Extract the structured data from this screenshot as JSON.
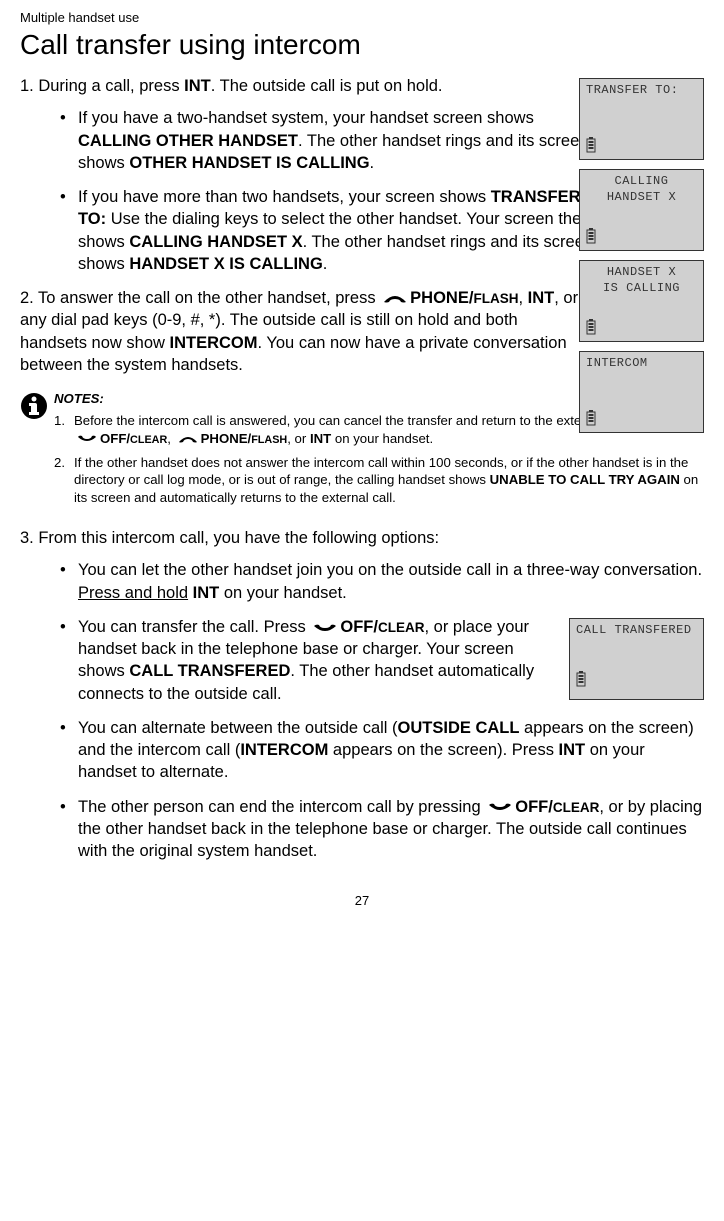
{
  "breadcrumb": "Multiple handset use",
  "title": "Call transfer using intercom",
  "lcd": {
    "transfer_to": "TRANSFER TO:",
    "calling_l1": "CALLING",
    "calling_l2": "HANDSET X",
    "iscalling_l1": "HANDSET X",
    "iscalling_l2": "IS CALLING",
    "intercom": "INTERCOM",
    "call_transfered": "CALL TRANSFERED"
  },
  "step1": {
    "lead_a": "1. During a call, press ",
    "lead_b": "INT",
    "lead_c": ". The outside call is put on hold.",
    "b1_a": "If you have a two-handset system, your handset screen shows ",
    "b1_b": "CALLING OTHER HANDSET",
    "b1_c": ". The other handset rings and its screen shows ",
    "b1_d": "OTHER HANDSET IS CALLING",
    "b1_e": ".",
    "b2_a": "If you have more than two handsets, your screen shows ",
    "b2_b": "TRANSFER TO:",
    "b2_c": " Use the dialing keys to select the other handset. Your screen then shows ",
    "b2_d": "CALLING HANDSET X",
    "b2_e": ". The other handset rings and its screen shows ",
    "b2_f": "HANDSET X IS CALLING",
    "b2_g": "."
  },
  "step2": {
    "a": "2. To answer the call on the other handset, press ",
    "phone_flash": "PHONE/",
    "flash_sc": "FLASH",
    "sep1": ", ",
    "int": "INT",
    "b": ", or any dial pad keys (0-9, #, *). The outside call is still on hold and both handsets now show ",
    "intercom": "INTERCOM",
    "c": ". You can now have a private conversation between the system handsets."
  },
  "notes": {
    "head": "NOTES:",
    "n1_num": "1.",
    "n1_a": "Before the intercom call is answered, you can cancel the transfer and return to the external call by pressing ",
    "off_clear": "OFF/",
    "clear_sc": "CLEAR",
    "n1_sep1": ", ",
    "phone_flash": "PHONE/",
    "flash_sc": "FLASH",
    "n1_sep2": ", or ",
    "int": "INT",
    "n1_b": " on your handset.",
    "n2_num": "2.",
    "n2_a": "If the other handset does not answer the intercom call within 100 seconds, or if the other handset is in the directory or call log mode, or is out of range, the calling handset shows ",
    "n2_b": "UNABLE TO CALL TRY AGAIN",
    "n2_c": " on its screen and automatically returns to the external call."
  },
  "step3": {
    "lead": "3. From this intercom call, you have the following options:",
    "b1_a": "You can let the other handset join you on the outside call in a three-way conversation. ",
    "b1_u": "Press and hold",
    "b1_b": " ",
    "b1_int": "INT",
    "b1_c": " on your handset.",
    "b2_a": "You can transfer the call. Press ",
    "off_clear": "OFF/",
    "clear_sc": "CLEAR",
    "b2_b": ", or place your handset back in the telephone base or charger. Your screen shows ",
    "b2_ct": "CALL TRANSFERED",
    "b2_c": ". The other handset automatically connects to the outside call.",
    "b3_a": "You can alternate between the outside call (",
    "b3_oc": "OUTSIDE CALL",
    "b3_b": " appears on the screen) and the intercom call (",
    "b3_ic": "INTERCOM",
    "b3_c": " appears on the screen). Press ",
    "b3_int": "INT",
    "b3_d": " on your handset to alternate.",
    "b4_a": "The other person can end the intercom call by pressing ",
    "b4_b": ", or by placing the other handset back in the telephone base or charger. The outside call continues with the original system handset."
  },
  "page_num": "27"
}
